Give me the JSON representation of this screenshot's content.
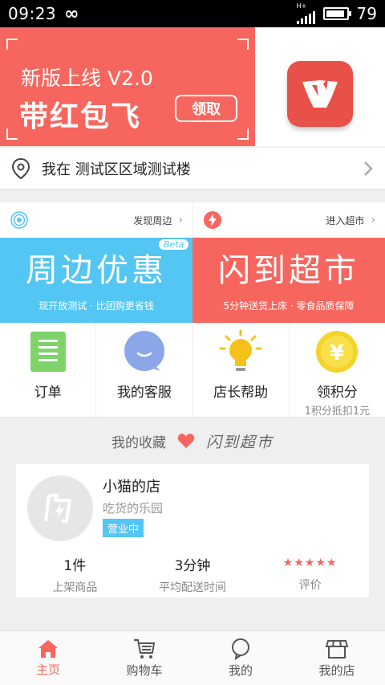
{
  "status_bar": {
    "time": "09:23",
    "infinity": "∞",
    "network": "H+",
    "battery": "79"
  },
  "banner": {
    "subtitle": "新版上线 V2.0",
    "title": "带红包飞",
    "button": "领取"
  },
  "location": {
    "text": "我在  测试区区域测试楼"
  },
  "promo": {
    "left_link": "发现周边",
    "right_link": "进入超市",
    "left_title": "周边优惠",
    "left_badge": "Beta",
    "left_desc": "现开放测试 · 比团购更省钱",
    "right_title": "闪到超市",
    "right_desc": "5分钟送货上床 · 零食品质保障"
  },
  "grid": {
    "items": [
      {
        "label": "订单",
        "sub": ""
      },
      {
        "label": "我的客服",
        "sub": ""
      },
      {
        "label": "店长帮助",
        "sub": ""
      },
      {
        "label": "领积分",
        "sub": "1积分抵扣1元",
        "icon_text": "¥"
      }
    ]
  },
  "favorites": {
    "label": "我的收藏",
    "brand": "闪到超市",
    "store": {
      "name": "小猫的店",
      "slogan": "吃货的乐园",
      "status": "营业中",
      "stats": [
        {
          "value": "1件",
          "label": "上架商品"
        },
        {
          "value": "3分钟",
          "label": "平均配送时间"
        },
        {
          "value": "",
          "label": "评价",
          "rating": 5
        }
      ]
    }
  },
  "bottom_nav": {
    "items": [
      {
        "label": "主页",
        "active": true
      },
      {
        "label": "购物车"
      },
      {
        "label": "我的"
      },
      {
        "label": "我的店"
      }
    ]
  },
  "colors": {
    "accent_red": "#f7665e",
    "accent_blue": "#54c6f4"
  }
}
